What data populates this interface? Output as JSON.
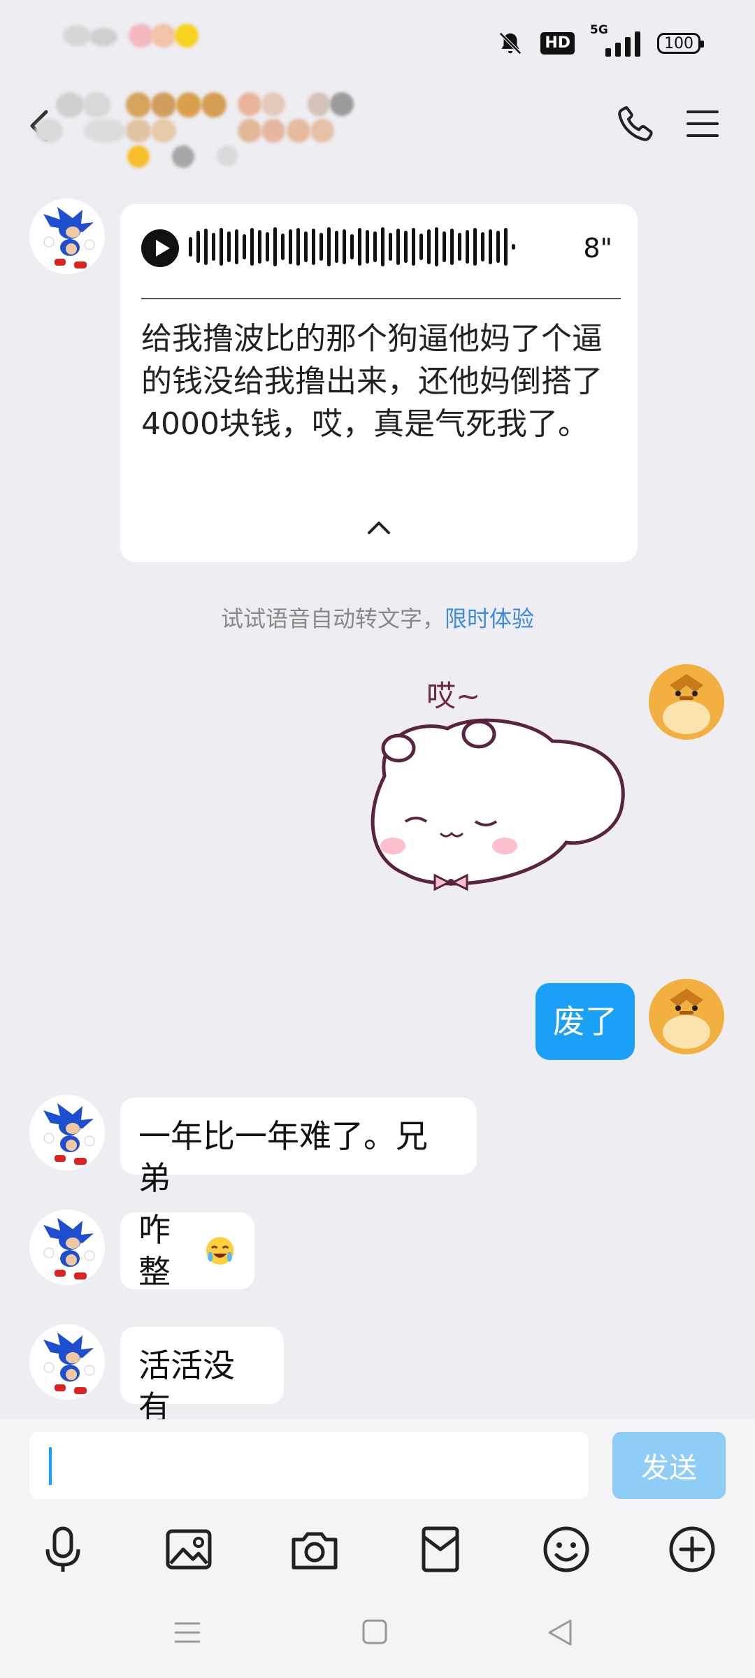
{
  "status_bar": {
    "network": "5G",
    "hd": "HD",
    "battery": "100"
  },
  "chat": {
    "voice_message": {
      "duration": "8\"",
      "transcript": "给我撸波比的那个狗逼他妈了个逼的钱没给我撸出来，还他妈倒搭了4000块钱，哎，真是气死我了。"
    },
    "hint": {
      "text": "试试语音自动转文字，",
      "link": "限时体验"
    },
    "sticker_text": "哎~",
    "messages": [
      {
        "from": "self",
        "text": "废了"
      },
      {
        "from": "other",
        "text": "一年比一年难了。兄弟"
      },
      {
        "from": "other",
        "text": "咋整"
      },
      {
        "from": "other",
        "text": "活活没有"
      }
    ]
  },
  "composer": {
    "value": "",
    "send_label": "发送"
  },
  "toolbar": [
    "microphone-icon",
    "image-icon",
    "camera-icon",
    "red-packet-icon",
    "emoji-icon",
    "plus-icon"
  ],
  "colors": {
    "accent": "#1aa1f7",
    "send_disabled": "#8fcdf7",
    "background": "#ededf2",
    "link": "#3c8be0"
  }
}
